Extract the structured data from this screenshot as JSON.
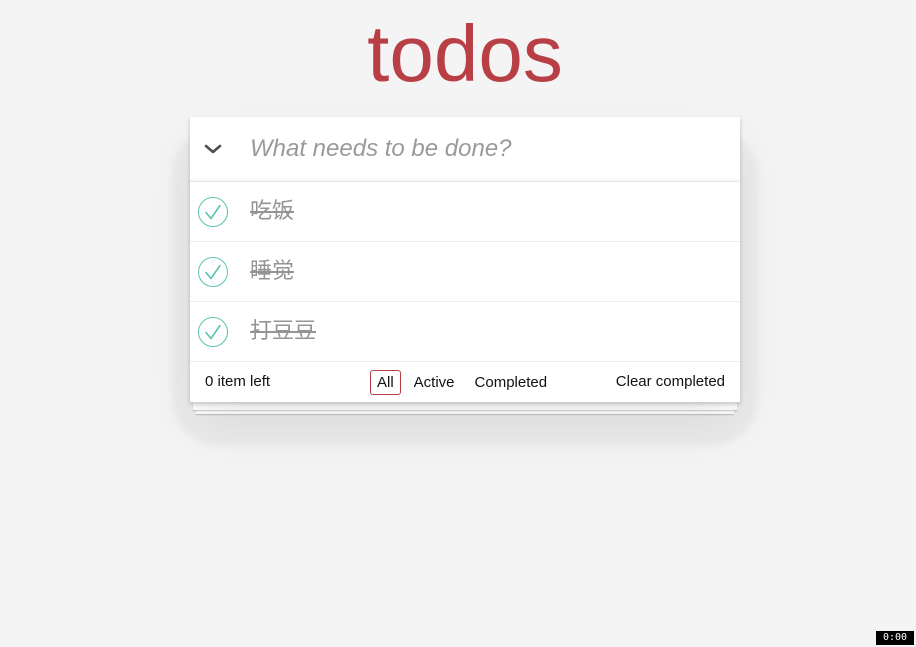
{
  "app": {
    "title": "todos",
    "accent_color": "#b83f45",
    "check_color": "#5dc2af"
  },
  "header": {
    "toggle_icon": "chevron-down-icon",
    "new_todo_placeholder": "What needs to be done?",
    "new_todo_value": ""
  },
  "todos": [
    {
      "label": "吃饭",
      "completed": true
    },
    {
      "label": "睡觉",
      "completed": true
    },
    {
      "label": "打豆豆",
      "completed": true
    }
  ],
  "footer": {
    "count_text": "0 item left",
    "filters": [
      {
        "label": "All",
        "selected": true
      },
      {
        "label": "Active",
        "selected": false
      },
      {
        "label": "Completed",
        "selected": false
      }
    ],
    "clear_label": "Clear completed"
  },
  "overlay": {
    "badge_text": "0:00"
  }
}
